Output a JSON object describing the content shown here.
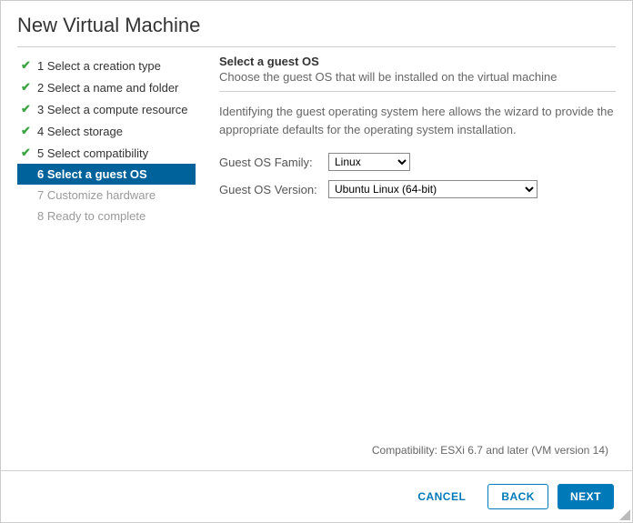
{
  "header": {
    "title": "New Virtual Machine"
  },
  "steps": [
    {
      "label": "1 Select a creation type"
    },
    {
      "label": "2 Select a name and folder"
    },
    {
      "label": "3 Select a compute resource"
    },
    {
      "label": "4 Select storage"
    },
    {
      "label": "5 Select compatibility"
    },
    {
      "label": "6 Select a guest OS"
    },
    {
      "label": "7 Customize hardware"
    },
    {
      "label": "8 Ready to complete"
    }
  ],
  "panel": {
    "title": "Select a guest OS",
    "subtitle": "Choose the guest OS that will be installed on the virtual machine",
    "description": "Identifying the guest operating system here allows the wizard to provide the appropriate defaults for the operating system installation."
  },
  "form": {
    "family_label": "Guest OS Family:",
    "family_value": "Linux",
    "version_label": "Guest OS Version:",
    "version_value": "Ubuntu Linux (64-bit)"
  },
  "compat": "Compatibility: ESXi 6.7 and later (VM version 14)",
  "footer": {
    "cancel": "CANCEL",
    "back": "BACK",
    "next": "NEXT"
  }
}
